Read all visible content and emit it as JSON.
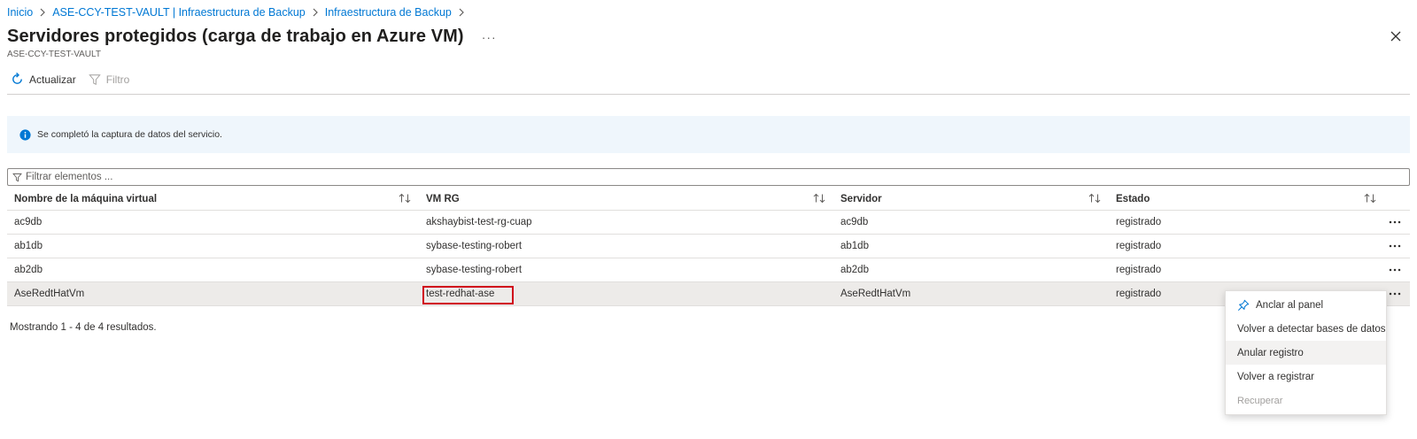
{
  "breadcrumb": [
    "Inicio",
    "ASE-CCY-TEST-VAULT | Infraestructura de Backup",
    "Infraestructura de Backup"
  ],
  "header": {
    "title": "Servidores protegidos (carga de trabajo en Azure VM)",
    "more": "···",
    "subtitle": "ASE-CCY-TEST-VAULT"
  },
  "toolbar": {
    "refresh": "Actualizar",
    "filter": "Filtro"
  },
  "info": {
    "message": "Se completó la captura de datos del servicio."
  },
  "filter": {
    "placeholder": "Filtrar elementos ..."
  },
  "grid": {
    "columns": [
      "Nombre de la máquina virtual",
      "VM RG",
      "Servidor",
      "Estado"
    ],
    "rows": [
      {
        "vm": "ac9db",
        "rg": "akshaybist-test-rg-cuap",
        "server": "ac9db",
        "state": "registrado"
      },
      {
        "vm": "ab1db",
        "rg": "sybase-testing-robert",
        "server": "ab1db",
        "state": "registrado"
      },
      {
        "vm": "ab2db",
        "rg": "sybase-testing-robert",
        "server": "ab2db",
        "state": "registrado"
      },
      {
        "vm": "AseRedtHatVm",
        "rg": "test-redhat-ase",
        "server": "AseRedtHatVm",
        "state": "registrado"
      }
    ]
  },
  "results": "Mostrando 1 - 4 de 4 resultados.",
  "context_menu": {
    "items": [
      "Anclar al panel",
      "Volver a detectar bases de datos",
      "Anular registro",
      "Volver a registrar",
      "Recuperar"
    ]
  },
  "colors": {
    "link": "#0078d4",
    "info_bg": "#eff6fc",
    "highlight": "#d0021b",
    "selected_row": "#edebe9"
  }
}
